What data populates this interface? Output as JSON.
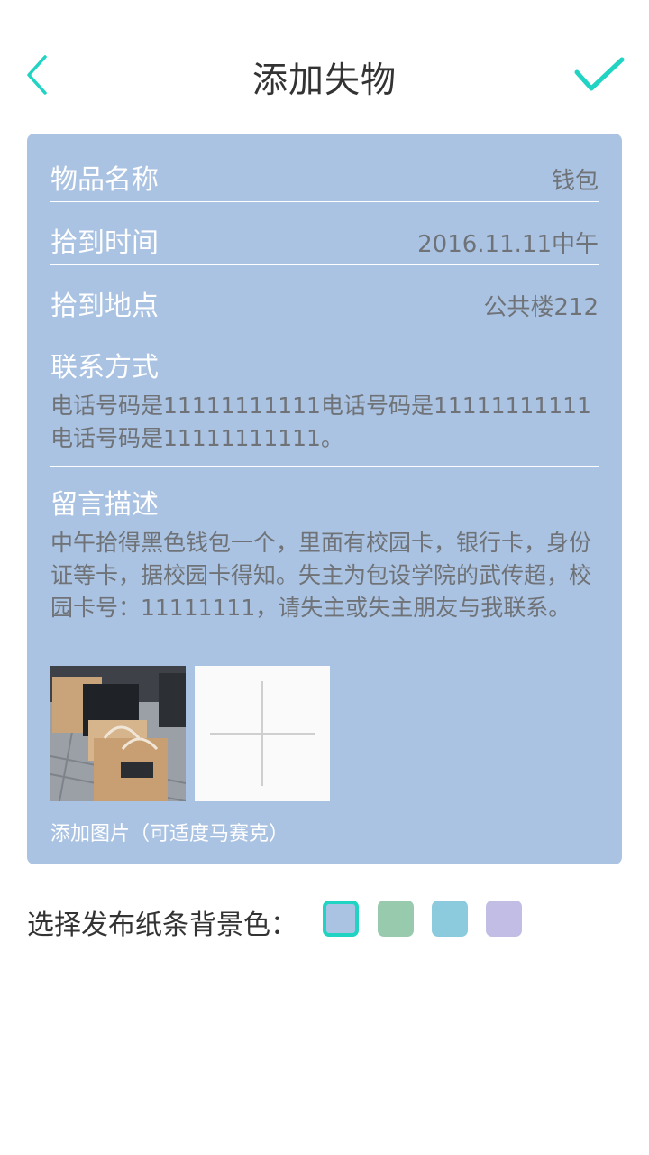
{
  "header": {
    "title": "添加失物",
    "back_icon": "chevron-left-icon",
    "confirm_icon": "check-icon",
    "accent_color": "#20d3c2"
  },
  "form": {
    "item_name": {
      "label": "物品名称",
      "value": "钱包"
    },
    "found_time": {
      "label": "拾到时间",
      "value": "2016.11.11中午"
    },
    "found_place": {
      "label": "拾到地点",
      "value": "公共楼212"
    },
    "contact": {
      "label": "联系方式",
      "value": "电话号码是11111111111电话号码是11111111111电话号码是11111111111。"
    },
    "message": {
      "label": "留言描述",
      "value": "中午拾得黑色钱包一个，里面有校园卡，银行卡，身份证等卡，据校园卡得知。失主为包设学院的武传超，校园卡号：11111111，请失主或失主朋友与我联系。"
    },
    "photo_caption": "添加图片（可适度马赛克）",
    "card_color": "#abc3e2"
  },
  "color_picker": {
    "label": "选择发布纸条背景色：",
    "swatches": [
      {
        "color": "#abc3e2",
        "selected": true
      },
      {
        "color": "#98cbad",
        "selected": false
      },
      {
        "color": "#8ccbde",
        "selected": false
      },
      {
        "color": "#c1bde4",
        "selected": false
      }
    ]
  }
}
